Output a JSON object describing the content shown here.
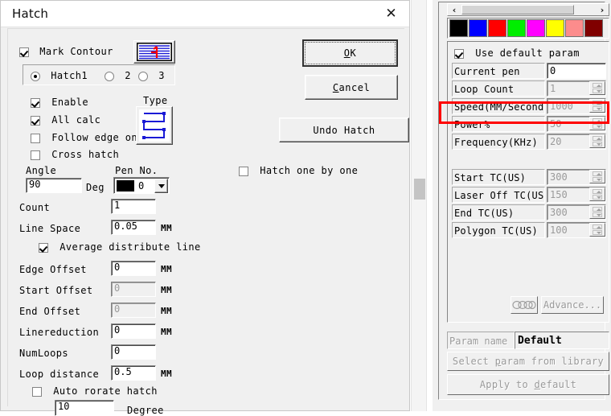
{
  "dialog": {
    "title": "Hatch",
    "close_icon": "✕",
    "mark_contour": {
      "label": "Mark Contour",
      "checked": true
    },
    "contour_icon": "hatch-preview-icon",
    "hatch_tabs": [
      {
        "label": "Hatch1",
        "selected": true
      },
      {
        "label": "2",
        "selected": false
      },
      {
        "label": "3",
        "selected": false
      }
    ],
    "enable": {
      "label": "Enable",
      "checked": true
    },
    "all_calc": {
      "label": "All calc",
      "checked": true
    },
    "follow_edge": {
      "label": "Follow edge on",
      "checked": false
    },
    "cross_hatch": {
      "label": "Cross hatch",
      "checked": false
    },
    "type_label": "Type",
    "angle_label": "Angle",
    "angle_value": "90",
    "deg_label": "Deg",
    "pen_no_label": "Pen No.",
    "pen_no_value": "0",
    "pen_color": "#000000",
    "fields": [
      {
        "label": "Count",
        "value": "1",
        "unit": "",
        "disabled": false
      },
      {
        "label": "Line Space",
        "value": "0.05",
        "unit": "MM",
        "disabled": false
      },
      {
        "label": "Edge Offset",
        "value": "0",
        "unit": "MM",
        "disabled": false
      },
      {
        "label": "Start Offset",
        "value": "0",
        "unit": "MM",
        "disabled": true
      },
      {
        "label": "End Offset",
        "value": "0",
        "unit": "MM",
        "disabled": true
      },
      {
        "label": "Linereduction",
        "value": "0",
        "unit": "MM",
        "disabled": false
      },
      {
        "label": "NumLoops",
        "value": "0",
        "unit": "",
        "disabled": false
      },
      {
        "label": "Loop distance",
        "value": "0.5",
        "unit": "MM",
        "disabled": false
      }
    ],
    "average_distribute": {
      "label": "Average distribute line",
      "checked": true
    },
    "auto_rotate": {
      "label": "Auto rorate hatch",
      "checked": false
    },
    "auto_rotate_value": "10",
    "degree_label": "Degree",
    "hatch_one_by_one": {
      "label": "Hatch one by one",
      "checked": false
    },
    "buttons": {
      "ok": "OK",
      "ok_mnemonic": "O",
      "cancel": "Cancel",
      "cancel_mnemonic": "C",
      "undo_hatch": "Undo Hatch"
    }
  },
  "right_panel": {
    "scroll_left_icon": "‹",
    "scroll_right_icon": "›",
    "color_swatches": [
      "#000000",
      "#0000ff",
      "#ff0000",
      "#00ee00",
      "#ff00ff",
      "#ffff00",
      "#fc8c8c",
      "#800000"
    ],
    "use_default_param": {
      "label": "Use default param",
      "checked": true
    },
    "rows": [
      {
        "label": "Current pen",
        "value": "0",
        "spinner": false,
        "disabled": false
      },
      {
        "label": "Loop Count",
        "value": "1",
        "spinner": true,
        "disabled": true
      },
      {
        "label": "Speed(MM/Second",
        "value": "1000",
        "spinner": true,
        "disabled": true
      },
      {
        "label": "Power%",
        "value": "50",
        "spinner": true,
        "disabled": true
      },
      {
        "label": "Frequency(KHz)",
        "value": "20",
        "spinner": true,
        "disabled": true
      },
      {
        "label": "Start TC(US)",
        "value": "300",
        "spinner": true,
        "disabled": true
      },
      {
        "label": "Laser Off TC(US",
        "value": "150",
        "spinner": true,
        "disabled": true
      },
      {
        "label": "End TC(US)",
        "value": "300",
        "spinner": true,
        "disabled": true
      },
      {
        "label": "Polygon TC(US)",
        "value": "100",
        "spinner": true,
        "disabled": true
      }
    ],
    "chain_icon": "chain-links-icon",
    "advance_button": "Advance...",
    "param_name_label": "Param name",
    "param_name_value": "Default",
    "select_param_button": "Select param from library",
    "apply_default_button": "Apply to default",
    "apply_default_mnemonic": "d",
    "select_param_mnemonic": "p",
    "highlight_color": "#ff0000"
  }
}
